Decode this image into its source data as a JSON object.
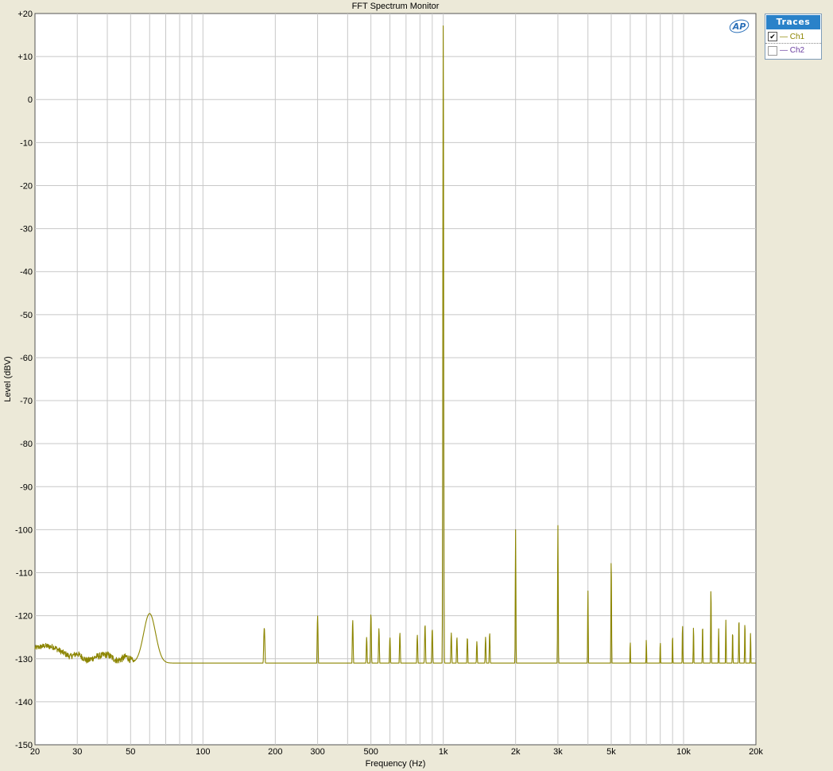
{
  "window": {
    "title": "FFT Spectrum Monitor"
  },
  "colors": {
    "ch1": "#8c8500",
    "ch2": "#6b3fa0",
    "grid": "#c8c8c8",
    "plot_bg": "#ffffff",
    "logo": "#2a6fb8",
    "legend_header": "#2a82c9"
  },
  "logo": {
    "text": "AP"
  },
  "legend": {
    "title": "Traces",
    "items": [
      {
        "label": "— Ch1",
        "checked": true,
        "check_glyph": "✔"
      },
      {
        "label": "— Ch2",
        "checked": false,
        "check_glyph": ""
      }
    ]
  },
  "chart_data": {
    "type": "line",
    "xscale": "log",
    "xlim": [
      20,
      20000
    ],
    "ylim": [
      -150,
      20
    ],
    "xlabel": "Frequency (Hz)",
    "ylabel": "Level (dBV)",
    "grid": true,
    "legend_position": "top-right-outside",
    "x_ticks": [
      {
        "value": 20,
        "label": "20"
      },
      {
        "value": 30,
        "label": "30"
      },
      {
        "value": 50,
        "label": "50"
      },
      {
        "value": 100,
        "label": "100"
      },
      {
        "value": 200,
        "label": "200"
      },
      {
        "value": 300,
        "label": "300"
      },
      {
        "value": 500,
        "label": "500"
      },
      {
        "value": 1000,
        "label": "1k"
      },
      {
        "value": 2000,
        "label": "2k"
      },
      {
        "value": 3000,
        "label": "3k"
      },
      {
        "value": 5000,
        "label": "5k"
      },
      {
        "value": 10000,
        "label": "10k"
      },
      {
        "value": 20000,
        "label": "20k"
      }
    ],
    "y_ticks": [
      {
        "value": 20,
        "label": "+20"
      },
      {
        "value": 10,
        "label": "+10"
      },
      {
        "value": 0,
        "label": "0"
      },
      {
        "value": -10,
        "label": "-10"
      },
      {
        "value": -20,
        "label": "-20"
      },
      {
        "value": -30,
        "label": "-30"
      },
      {
        "value": -40,
        "label": "-40"
      },
      {
        "value": -50,
        "label": "-50"
      },
      {
        "value": -60,
        "label": "-60"
      },
      {
        "value": -70,
        "label": "-70"
      },
      {
        "value": -80,
        "label": "-80"
      },
      {
        "value": -90,
        "label": "-90"
      },
      {
        "value": -100,
        "label": "-100"
      },
      {
        "value": -110,
        "label": "-110"
      },
      {
        "value": -120,
        "label": "-120"
      },
      {
        "value": -130,
        "label": "-130"
      },
      {
        "value": -140,
        "label": "-140"
      },
      {
        "value": -150,
        "label": "-150"
      }
    ],
    "series": [
      {
        "name": "Ch1",
        "color": "#8c8500",
        "noise_floor_points": [
          [
            20,
            -127.5
          ],
          [
            22,
            -127.0
          ],
          [
            24,
            -127.3
          ],
          [
            26,
            -128.5
          ],
          [
            28,
            -129.5
          ],
          [
            30,
            -128.8
          ],
          [
            33,
            -130.5
          ],
          [
            36,
            -129.5
          ],
          [
            40,
            -129.0
          ],
          [
            44,
            -130.5
          ],
          [
            48,
            -129.5
          ],
          [
            52,
            -131.0
          ],
          [
            56,
            -130.5
          ],
          [
            60,
            -131.0
          ],
          [
            70,
            -131.8
          ],
          [
            80,
            -132.5
          ],
          [
            100,
            -133.0
          ],
          [
            130,
            -133.3
          ],
          [
            170,
            -133.8
          ],
          [
            200,
            -134.3
          ],
          [
            300,
            -134.6
          ],
          [
            500,
            -134.6
          ],
          [
            700,
            -134.3
          ],
          [
            900,
            -133.8
          ],
          [
            1100,
            -134.5
          ],
          [
            1500,
            -134.8
          ],
          [
            2000,
            -135.0
          ],
          [
            3000,
            -135.0
          ],
          [
            5000,
            -135.2
          ],
          [
            7000,
            -135.2
          ],
          [
            10000,
            -134.8
          ],
          [
            15000,
            -134.5
          ],
          [
            20000,
            -134.0
          ]
        ],
        "noise_amplitude": 1.5,
        "peaks": [
          {
            "freq": 60,
            "level": -119.5,
            "width": 0.035
          },
          {
            "freq": 180,
            "level": -122.8,
            "width": 0.004
          },
          {
            "freq": 300,
            "level": -120.0,
            "width": 0.003
          },
          {
            "freq": 420,
            "level": -121.0,
            "width": 0.003
          },
          {
            "freq": 480,
            "level": -125.0,
            "width": 0.003
          },
          {
            "freq": 500,
            "level": -119.5,
            "width": 0.003
          },
          {
            "freq": 540,
            "level": -123.0,
            "width": 0.003
          },
          {
            "freq": 600,
            "level": -125.0,
            "width": 0.003
          },
          {
            "freq": 660,
            "level": -124.0,
            "width": 0.003
          },
          {
            "freq": 780,
            "level": -124.5,
            "width": 0.003
          },
          {
            "freq": 840,
            "level": -122.0,
            "width": 0.003
          },
          {
            "freq": 900,
            "level": -123.0,
            "width": 0.003
          },
          {
            "freq": 1000,
            "level": 18.3,
            "width": 0.0025
          },
          {
            "freq": 1080,
            "level": -124.0,
            "width": 0.003
          },
          {
            "freq": 1140,
            "level": -125.0,
            "width": 0.003
          },
          {
            "freq": 1260,
            "level": -125.0,
            "width": 0.003
          },
          {
            "freq": 1380,
            "level": -126.0,
            "width": 0.003
          },
          {
            "freq": 1500,
            "level": -125.0,
            "width": 0.003
          },
          {
            "freq": 1560,
            "level": -124.0,
            "width": 0.003
          },
          {
            "freq": 2000,
            "level": -100.0,
            "width": 0.002
          },
          {
            "freq": 3000,
            "level": -98.8,
            "width": 0.002
          },
          {
            "freq": 4000,
            "level": -114.0,
            "width": 0.002
          },
          {
            "freq": 5000,
            "level": -106.5,
            "width": 0.002
          },
          {
            "freq": 6000,
            "level": -126.0,
            "width": 0.002
          },
          {
            "freq": 7000,
            "level": -125.5,
            "width": 0.002
          },
          {
            "freq": 8000,
            "level": -126.0,
            "width": 0.002
          },
          {
            "freq": 9000,
            "level": -124.5,
            "width": 0.002
          },
          {
            "freq": 9900,
            "level": -122.0,
            "width": 0.002
          },
          {
            "freq": 11000,
            "level": -122.5,
            "width": 0.002
          },
          {
            "freq": 12000,
            "level": -122.0,
            "width": 0.002
          },
          {
            "freq": 13000,
            "level": -113.5,
            "width": 0.002
          },
          {
            "freq": 14000,
            "level": -123.0,
            "width": 0.002
          },
          {
            "freq": 15000,
            "level": -121.0,
            "width": 0.002
          },
          {
            "freq": 16000,
            "level": -123.5,
            "width": 0.002
          },
          {
            "freq": 17000,
            "level": -120.5,
            "width": 0.002
          },
          {
            "freq": 18000,
            "level": -121.5,
            "width": 0.002
          },
          {
            "freq": 19000,
            "level": -124.0,
            "width": 0.002
          }
        ]
      }
    ]
  }
}
